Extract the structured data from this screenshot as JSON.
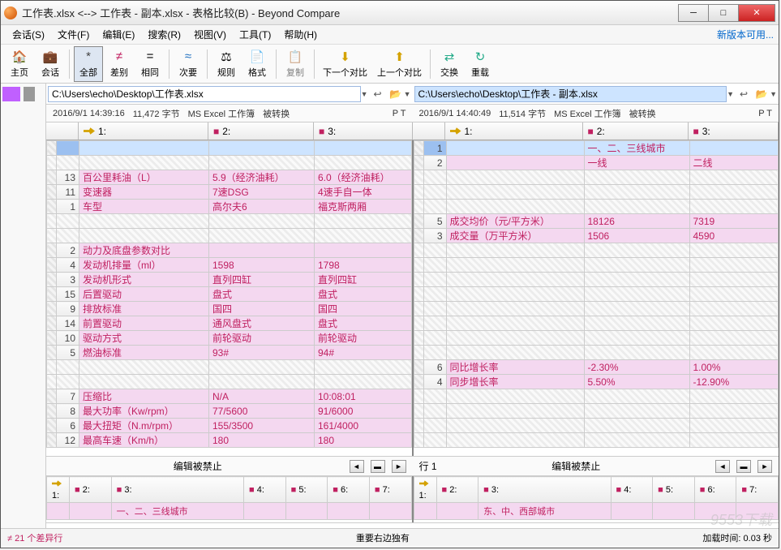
{
  "window": {
    "title": "工作表.xlsx <--> 工作表 - 副本.xlsx - 表格比较(B) - Beyond Compare"
  },
  "menubar": {
    "items": [
      "会话(S)",
      "文件(F)",
      "编辑(E)",
      "搜索(R)",
      "视图(V)",
      "工具(T)",
      "帮助(H)"
    ],
    "update": "新版本可用..."
  },
  "toolbar": {
    "home": "主页",
    "session": "会话",
    "all": "全部",
    "diff": "差别",
    "same": "相同",
    "minor": "次要",
    "rules": "规则",
    "format": "格式",
    "copy": "复制",
    "nextdiff": "下一个对比",
    "prevdiff": "上一个对比",
    "swap": "交换",
    "reload": "重载"
  },
  "paths": {
    "left": "C:\\Users\\echo\\Desktop\\工作表.xlsx",
    "right": "C:\\Users\\echo\\Desktop\\工作表 - 副本.xlsx"
  },
  "info": {
    "left": {
      "date": "2016/9/1 14:39:16",
      "size": "11,472 字节",
      "type": "MS Excel 工作簿",
      "conv": "被转换",
      "pt": "P T"
    },
    "right": {
      "date": "2016/9/1 14:40:49",
      "size": "11,514 字节",
      "type": "MS Excel 工作簿",
      "conv": "被转换",
      "pt": "P T"
    }
  },
  "headers": {
    "c1": "1:",
    "c2": "2:",
    "c3": "3:"
  },
  "left_rows": [
    {
      "n": "",
      "c1": "",
      "c2": "",
      "c3": "",
      "style": "selected"
    },
    {
      "empty": true
    },
    {
      "n": "13",
      "c1": "百公里耗油（L）",
      "c2": "5.9（经济油耗）",
      "c3": "6.0（经济油耗）",
      "style": "diff"
    },
    {
      "n": "11",
      "c1": "变速器",
      "c2": "7速DSG",
      "c3": "4速手自一体",
      "style": "diff"
    },
    {
      "n": "1",
      "c1": "车型",
      "c2": "高尔夫6",
      "c3": "福克斯两厢",
      "style": "diff"
    },
    {
      "empty": true
    },
    {
      "empty": true
    },
    {
      "n": "2",
      "c1": "动力及底盘参数对比",
      "c2": "",
      "c3": "",
      "style": "diff"
    },
    {
      "n": "4",
      "c1": "发动机排量（ml）",
      "c2": "1598",
      "c3": "1798",
      "style": "diff"
    },
    {
      "n": "3",
      "c1": "发动机形式",
      "c2": "直列四缸",
      "c3": "直列四缸",
      "style": "diff"
    },
    {
      "n": "15",
      "c1": "后置驱动",
      "c2": "盘式",
      "c3": "盘式",
      "style": "diff"
    },
    {
      "n": "9",
      "c1": "排放标准",
      "c2": "国四",
      "c3": "国四",
      "style": "diff"
    },
    {
      "n": "14",
      "c1": "前置驱动",
      "c2": "通风盘式",
      "c3": "盘式",
      "style": "diff"
    },
    {
      "n": "10",
      "c1": "驱动方式",
      "c2": "前轮驱动",
      "c3": "前轮驱动",
      "style": "diff"
    },
    {
      "n": "5",
      "c1": "燃油标准",
      "c2": "93#",
      "c3": "94#",
      "style": "diff"
    },
    {
      "empty": true
    },
    {
      "empty": true
    },
    {
      "n": "7",
      "c1": "压缩比",
      "c2": "N/A",
      "c3": "10:08:01",
      "style": "diff"
    },
    {
      "n": "8",
      "c1": "最大功率（Kw/rpm）",
      "c2": "77/5600",
      "c3": "91/6000",
      "style": "diff"
    },
    {
      "n": "6",
      "c1": "最大扭矩（N.m/rpm）",
      "c2": "155/3500",
      "c3": "161/4000",
      "style": "diff"
    },
    {
      "n": "12",
      "c1": "最高车速（Km/h）",
      "c2": "180",
      "c3": "180",
      "style": "diff"
    }
  ],
  "right_rows": [
    {
      "n": "1",
      "c1": "",
      "c2": "一、二、三线城市",
      "c3": "",
      "style": "selected diff"
    },
    {
      "n": "2",
      "c1": "",
      "c2": "一线",
      "c3": "二线",
      "style": "diff"
    },
    {
      "empty": true
    },
    {
      "empty": true
    },
    {
      "empty": true
    },
    {
      "n": "5",
      "c1": "成交均价（元/平方米）",
      "c2": "18126",
      "c3": "7319",
      "style": "diff"
    },
    {
      "n": "3",
      "c1": "成交量（万平方米）",
      "c2": "1506",
      "c3": "4590",
      "style": "diff"
    },
    {
      "empty": true
    },
    {
      "empty": true
    },
    {
      "empty": true
    },
    {
      "empty": true
    },
    {
      "empty": true
    },
    {
      "empty": true
    },
    {
      "empty": true
    },
    {
      "empty": true
    },
    {
      "n": "6",
      "c1": "同比增长率",
      "c2": "-2.30%",
      "c3": "1.00%",
      "style": "diff"
    },
    {
      "n": "4",
      "c1": "同步增长率",
      "c2": "5.50%",
      "c3": "-12.90%",
      "style": "diff"
    },
    {
      "empty": true
    },
    {
      "empty": true
    },
    {
      "empty": true
    },
    {
      "empty": true
    }
  ],
  "below": {
    "left_info": "编辑被禁止",
    "right_line": "行 1",
    "right_info": "编辑被禁止"
  },
  "bottom_headers": [
    "2:",
    "3:",
    "4:",
    "5:",
    "6:",
    "7:"
  ],
  "bottom_left_row": [
    "",
    "一、二、三线城市",
    "",
    "",
    ""
  ],
  "bottom_right_row": [
    "",
    "东、中、西部城市",
    "",
    "",
    ""
  ],
  "status": {
    "diffs": "21 个差异行",
    "note": "重要右边独有",
    "load": "加载时间: 0.03 秒"
  },
  "watermark": "9553下载"
}
